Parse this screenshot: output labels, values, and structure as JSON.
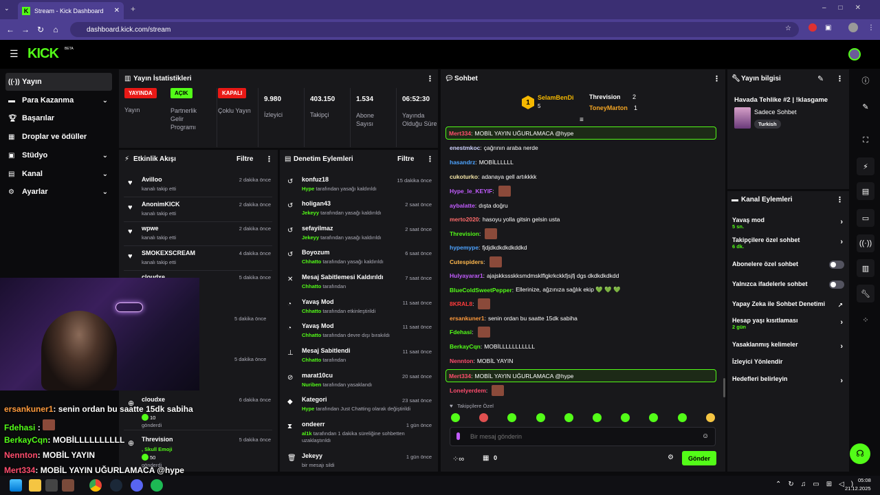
{
  "browser": {
    "tab_title": "Stream - Kick Dashboard",
    "url": "dashboard.kick.com/stream"
  },
  "header": {
    "logo": "KICK",
    "beta": "BETA"
  },
  "sidebar": {
    "items": [
      {
        "label": "Yayın"
      },
      {
        "label": "Para Kazanma"
      },
      {
        "label": "Başarılar"
      },
      {
        "label": "Droplar ve ödüller"
      },
      {
        "label": "Stüdyo"
      },
      {
        "label": "Kanal"
      },
      {
        "label": "Ayarlar"
      }
    ]
  },
  "stats": {
    "title": "Yayın İstatistikleri",
    "cols": [
      {
        "badge": "YAYINDA",
        "label": "Yayın"
      },
      {
        "badge": "AÇIK",
        "label": "Partnerlik Gelir Programı"
      },
      {
        "badge": "KAPALI",
        "label": "Çoklu Yayın"
      },
      {
        "value": "9.980",
        "label": "İzleyici"
      },
      {
        "value": "403.150",
        "label": "Takipçi"
      },
      {
        "value": "1.534",
        "label": "Abone Sayısı"
      },
      {
        "value": "06:52:30",
        "label": "Yayında Olduğu Süre"
      }
    ]
  },
  "activity": {
    "title": "Etkinlik Akışı",
    "filter": "Filtre",
    "items": [
      {
        "name": "Avilloo",
        "sub": "kanalı takip etti",
        "time": "2 dakika önce"
      },
      {
        "name": "AnonimKICK",
        "sub": "kanalı takip etti",
        "time": "2 dakika önce"
      },
      {
        "name": "wpwe",
        "sub": "kanalı takip etti",
        "time": "2 dakika önce"
      },
      {
        "name": "SMOKEXSCREAM",
        "sub": "kanalı takip etti",
        "time": "4 dakika önce"
      },
      {
        "name": "cloudxe",
        "sub": "",
        "time": "5 dakika önce"
      }
    ],
    "extra_times": [
      "5 dakika önce",
      "5 dakika önce"
    ],
    "gift1": {
      "name": "cloudxe",
      "count": "10",
      "sub": "gönderdi",
      "time": "6 dakika önce"
    },
    "gift2": {
      "name": "Threvision",
      "emoji": ", Skull Emoji",
      "count": "50",
      "sub": "gönderdi",
      "time": "5 dakika önce"
    }
  },
  "moderation": {
    "title": "Denetim Eylemleri",
    "filter": "Filtre",
    "items": [
      {
        "name": "konfuz18",
        "who": "Hype",
        "sub": " tarafından yasağı kaldırıldı",
        "time": "15 dakika önce"
      },
      {
        "name": "holigan43",
        "who": "Jekeyy",
        "sub": " tarafından yasağı kaldırıldı",
        "time": "2 saat önce"
      },
      {
        "name": "sefayilmaz",
        "who": "Jekeyy",
        "sub": " tarafından yasağı kaldırıldı",
        "time": "2 saat önce"
      },
      {
        "name": "Boyozum",
        "who": "Chhatto",
        "sub": " tarafından yasağı kaldırıldı",
        "time": "6 saat önce"
      },
      {
        "name": "Mesaj Sabitlemesi Kaldırıldı",
        "who": "Chhatto",
        "sub": " tarafından",
        "time": "7 saat önce"
      },
      {
        "name": "Yavaş Mod",
        "who": "Chhatto",
        "sub": " tarafından etkinleştirildi",
        "time": "11 saat önce"
      },
      {
        "name": "Yavaş Mod",
        "who": "Chhatto",
        "sub": " tarafından devre dışı bırakıldı",
        "time": "11 saat önce"
      },
      {
        "name": "Mesaj Sabitlendi",
        "who": "Chhatto",
        "sub": " tarafından",
        "time": "11 saat önce"
      },
      {
        "name": "marat10cu",
        "who": "Nuriben",
        "sub": " tarafından yasaklandı",
        "time": "20 saat önce"
      },
      {
        "name": "Kategori",
        "who": "Hype",
        "sub": " tarafından Just Chatting olarak değiştirildi",
        "time": "23 saat önce"
      },
      {
        "name": "ondeerr",
        "who": "al1k",
        "sub": " tarafından 1 dakika süreliğine sohbetten uzaklaştırıldı",
        "time": "1 gün önce"
      },
      {
        "name": "Jekeyy",
        "who": "",
        "sub": "bir mesajı sildi",
        "time": "1 gün önce"
      }
    ]
  },
  "chat": {
    "title": "Sohbet",
    "leader": {
      "first": "SelamBenDi",
      "first_count": "5",
      "second": "Threvision",
      "second_count": "2",
      "third": "ToneyMarton",
      "third_count": "1"
    },
    "messages": [
      {
        "user": "Mert334",
        "text": "MOBİL YAYIN UĞURLAMACA @hype",
        "color": "#ff4d6d",
        "hl": true
      },
      {
        "user": "enestmkoc",
        "text": "çağrının araba nerde",
        "color": "#cfd2ff"
      },
      {
        "user": "hasandrz",
        "text": "MOBİLLLLLL",
        "color": "#4da3ff"
      },
      {
        "user": "cukoturko",
        "text": "adanaya gell artıkkkk",
        "color": "#f5e6a8"
      },
      {
        "user": "Hype_le_KEYIF",
        "text": "",
        "color": "#c25cff"
      },
      {
        "user": "aybalatte",
        "text": "dışta doğru",
        "color": "#c25cff"
      },
      {
        "user": "merto2020",
        "text": "hasoyu yolla gitsin gelsin usta",
        "color": "#ff6b6b"
      },
      {
        "user": "Threvision",
        "text": "",
        "color": "#53fc18"
      },
      {
        "user": "hypemype",
        "text": "fjdjdkdkdkdkddkd",
        "color": "#4da3ff"
      },
      {
        "user": "Cutespiders",
        "text": "",
        "color": "#ffb84d"
      },
      {
        "user": "Hulyayarar1",
        "text": "ajajskkssskksmdmsklflgkrkckkfjsjfj dgs dkdkdkdkdd",
        "color": "#c25cff"
      },
      {
        "user": "BlueColdSweetPepper",
        "text": "Ellerinize, ağzınıza sağlık ekip 💚 💚 💚",
        "color": "#53fc18"
      },
      {
        "user": "8KRAL8",
        "text": "",
        "color": "#ff3b3b"
      },
      {
        "user": "ersankuner1",
        "text": "senin ordan bu saatte 15dk sabiha",
        "color": "#ff9a3c"
      },
      {
        "user": "Fdehasi",
        "text": "",
        "color": "#53fc18"
      },
      {
        "user": "BerkayCqn",
        "text": "MOBİLLLLLLLLLLL",
        "color": "#53fc18"
      },
      {
        "user": "Nennton",
        "text": "MOBİL YAYIN",
        "color": "#ff4d6d"
      },
      {
        "user": "Mert334",
        "text": "MOBİL YAYIN UĞURLAMACA @hype",
        "color": "#ff4d6d",
        "hl": true
      },
      {
        "user": "Lonelyerdem",
        "text": "",
        "color": "#ff4d6d"
      }
    ],
    "followers_label": "Takipçilere Özel",
    "placeholder": "Bir mesaj gönderin",
    "count": "0",
    "send": "Gönder"
  },
  "info": {
    "title": "Yayın bilgisi",
    "stream_title": "Havada Tehlike #2 | !klasgame",
    "category": "Sadece Sohbet",
    "tag": "Turkish"
  },
  "channel_actions": {
    "title": "Kanal Eylemleri",
    "items": [
      {
        "label": "Yavaş mod",
        "sub": "5 sn."
      },
      {
        "label": "Takipçilere özel sohbet",
        "sub": "6 dk."
      },
      {
        "label": "Abonelere özel sohbet",
        "sub": ""
      },
      {
        "label": "Yalnızca ifadelerle sohbet",
        "sub": ""
      },
      {
        "label": "Yapay Zeka ile Sohbet Denetimi",
        "sub": ""
      },
      {
        "label": "Hesap yaşı kısıtlaması",
        "sub": "2 gün"
      },
      {
        "label": "Yasaklanmış kelimeler",
        "sub": ""
      },
      {
        "label": "İzleyici Yönlendir",
        "sub": ""
      },
      {
        "label": "Hedefleri belirleyin",
        "sub": ""
      }
    ]
  },
  "overlay": {
    "lines": [
      {
        "user": "ersankuner1",
        "text": ": senin ordan bu saatte 15dk sabiha",
        "color": "#ff9a3c"
      },
      {
        "user": "Fdehasi",
        "text": " :",
        "color": "#53fc18"
      },
      {
        "user": "BerkayCqn",
        "text": ": MOBİLLLLLLLLLL",
        "color": "#53fc18"
      },
      {
        "user": "Nennton",
        "text": ": MOBİL YAYIN",
        "color": "#ff4d6d"
      },
      {
        "user": "Mert334",
        "text": ": MOBİL YAYIN UĞURLAMACA @hype",
        "color": "#ff4d6d"
      },
      {
        "user": "Lonelyerdem",
        "text": "",
        "color": "#ff4d6d"
      }
    ]
  },
  "taskbar": {
    "time": "05:08",
    "date": "21.12.2025"
  },
  "colors": {
    "accent": "#53fc18",
    "live": "#e91916",
    "panel": "#18181b"
  }
}
